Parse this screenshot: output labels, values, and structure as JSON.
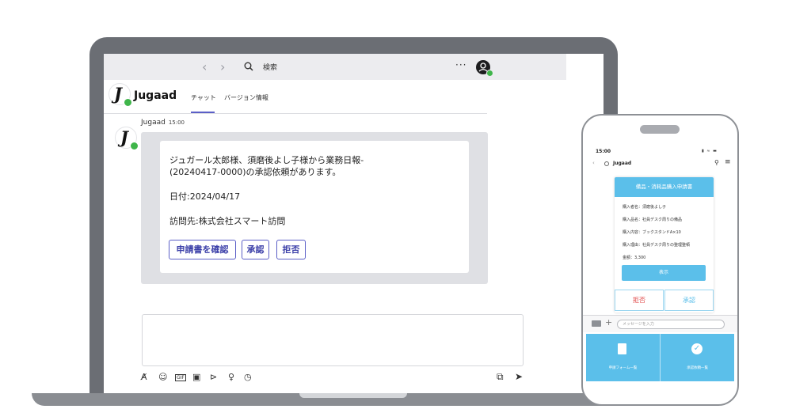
{
  "desktop": {
    "topbar": {
      "back_glyph": "‹",
      "forward_glyph": "›",
      "search_icon": "search-icon",
      "search_label": "検索",
      "more": "···",
      "avatar_icon": "user-avatar-icon"
    },
    "app": {
      "logo_letter": "J",
      "name": "Jugaad",
      "tabs": [
        {
          "label": "チャット",
          "active": true
        },
        {
          "label": "バージョン情報",
          "active": false
        }
      ]
    },
    "message": {
      "sender": "Jugaad",
      "time": "15:00",
      "card": {
        "line1": "ジュガール太郎様、須磨後よし子様から業務日報-",
        "line2": "(20240417-0000)の承認依頼があります。",
        "date": "日付:2024/04/17",
        "visit": "訪問先:株式会社スマート訪問",
        "buttons": [
          "申請書を確認",
          "承認",
          "拒否"
        ]
      }
    },
    "toolbar_icons": [
      "format-icon",
      "emoji-icon",
      "gif-icon",
      "sticker-icon",
      "loop-icon",
      "praise-icon",
      "schedule-icon"
    ],
    "toolbar_glyphs": [
      "A̸",
      "☺",
      "GIF",
      "▣",
      "⊳",
      "♀",
      "◷"
    ],
    "right_icons": [
      "attach-icon",
      "send-icon"
    ],
    "right_glyphs": [
      "⧉",
      "➤"
    ]
  },
  "phone": {
    "time": "15:00",
    "status_icons": "▮ ≈ ▬",
    "header": {
      "back": "‹",
      "title": "Jugaad",
      "search": "⚲",
      "menu": "≡"
    },
    "card": {
      "title": "備品・消耗品購入申請書",
      "lines": [
        "購入者名：須磨後よし子",
        "購入品名：社員デスク周りの備品",
        "購入内容：ブックスタンドA×10",
        "購入理由：社員デスク周りの整理整頓",
        "金額：3,300"
      ],
      "show": "表示",
      "reject": "拒否",
      "approve": "承認"
    },
    "input_placeholder": "メッセージを入力",
    "plus": "+",
    "tabs": [
      "申請フォーム一覧",
      "承認依頼一覧"
    ],
    "colors": {
      "accent": "#5bbfea",
      "reject": "#e04848"
    }
  }
}
